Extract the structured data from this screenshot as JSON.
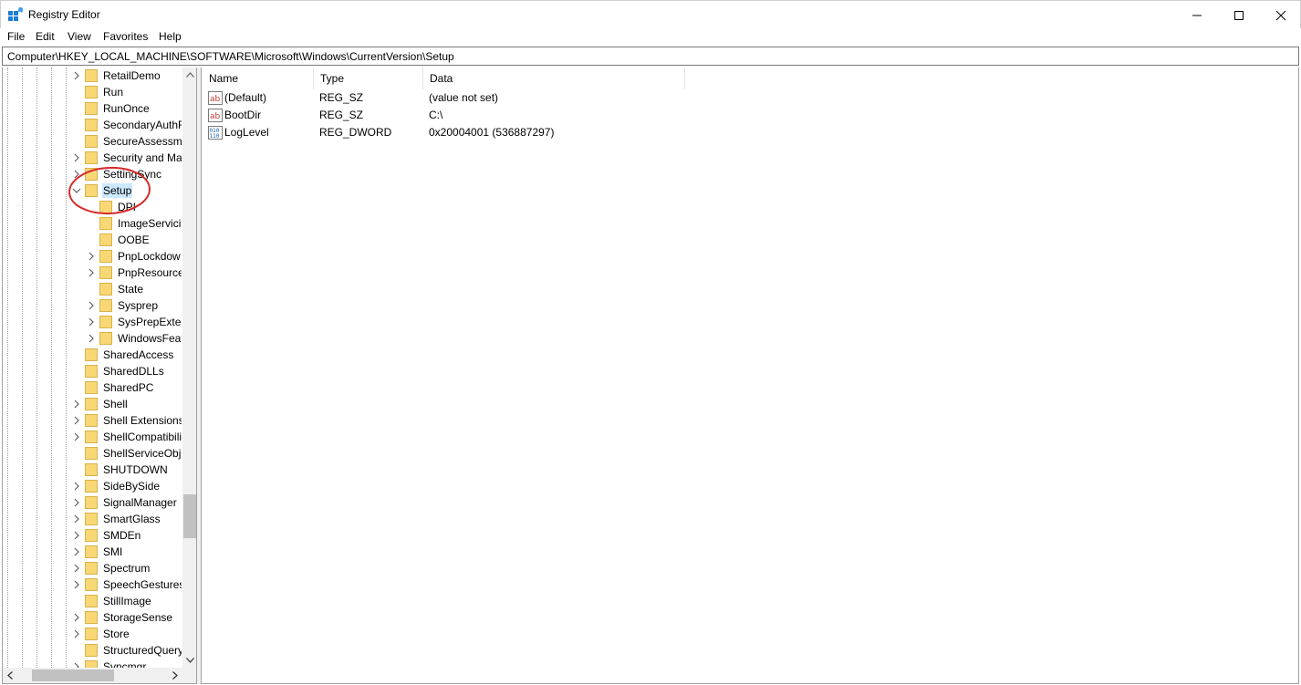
{
  "window": {
    "title": "Registry Editor"
  },
  "menu": {
    "items": [
      "File",
      "Edit",
      "View",
      "Favorites",
      "Help"
    ]
  },
  "address": {
    "path": "Computer\\HKEY_LOCAL_MACHINE\\SOFTWARE\\Microsoft\\Windows\\CurrentVersion\\Setup"
  },
  "tree": {
    "selected": "Setup",
    "items": [
      {
        "label": "RetailDemo",
        "level": 1,
        "expander": "collapsed"
      },
      {
        "label": "Run",
        "level": 1,
        "expander": "none"
      },
      {
        "label": "RunOnce",
        "level": 1,
        "expander": "none"
      },
      {
        "label": "SecondaryAuthF",
        "level": 1,
        "expander": "none"
      },
      {
        "label": "SecureAssessme",
        "level": 1,
        "expander": "none"
      },
      {
        "label": "Security and Ma",
        "level": 1,
        "expander": "collapsed"
      },
      {
        "label": "SettingSync",
        "level": 1,
        "expander": "collapsed"
      },
      {
        "label": "Setup",
        "level": 1,
        "expander": "expanded"
      },
      {
        "label": "DPI",
        "level": 2,
        "expander": "none"
      },
      {
        "label": "ImageServicir",
        "level": 2,
        "expander": "none"
      },
      {
        "label": "OOBE",
        "level": 2,
        "expander": "none"
      },
      {
        "label": "PnpLockdow",
        "level": 2,
        "expander": "collapsed"
      },
      {
        "label": "PnpResource",
        "level": 2,
        "expander": "collapsed"
      },
      {
        "label": "State",
        "level": 2,
        "expander": "none"
      },
      {
        "label": "Sysprep",
        "level": 2,
        "expander": "collapsed"
      },
      {
        "label": "SysPrepExterr",
        "level": 2,
        "expander": "collapsed"
      },
      {
        "label": "WindowsFeat",
        "level": 2,
        "expander": "collapsed"
      },
      {
        "label": "SharedAccess",
        "level": 1,
        "expander": "none"
      },
      {
        "label": "SharedDLLs",
        "level": 1,
        "expander": "none"
      },
      {
        "label": "SharedPC",
        "level": 1,
        "expander": "none"
      },
      {
        "label": "Shell",
        "level": 1,
        "expander": "collapsed"
      },
      {
        "label": "Shell Extensions",
        "level": 1,
        "expander": "collapsed"
      },
      {
        "label": "ShellCompatibili",
        "level": 1,
        "expander": "collapsed"
      },
      {
        "label": "ShellServiceObje",
        "level": 1,
        "expander": "none"
      },
      {
        "label": "SHUTDOWN",
        "level": 1,
        "expander": "none"
      },
      {
        "label": "SideBySide",
        "level": 1,
        "expander": "collapsed"
      },
      {
        "label": "SignalManager",
        "level": 1,
        "expander": "collapsed"
      },
      {
        "label": "SmartGlass",
        "level": 1,
        "expander": "collapsed"
      },
      {
        "label": "SMDEn",
        "level": 1,
        "expander": "collapsed"
      },
      {
        "label": "SMI",
        "level": 1,
        "expander": "collapsed"
      },
      {
        "label": "Spectrum",
        "level": 1,
        "expander": "collapsed"
      },
      {
        "label": "SpeechGestures",
        "level": 1,
        "expander": "collapsed"
      },
      {
        "label": "StillImage",
        "level": 1,
        "expander": "none"
      },
      {
        "label": "StorageSense",
        "level": 1,
        "expander": "collapsed"
      },
      {
        "label": "Store",
        "level": 1,
        "expander": "collapsed"
      },
      {
        "label": "StructuredQuery",
        "level": 1,
        "expander": "none"
      },
      {
        "label": "Syncmgr",
        "level": 1,
        "expander": "collapsed"
      }
    ]
  },
  "list": {
    "columns": [
      "Name",
      "Type",
      "Data"
    ],
    "rows": [
      {
        "name": "(Default)",
        "type": "REG_SZ",
        "data": "(value not set)",
        "icon": "string-value-icon"
      },
      {
        "name": "BootDir",
        "type": "REG_SZ",
        "data": "C:\\",
        "icon": "string-value-icon"
      },
      {
        "name": "LogLevel",
        "type": "REG_DWORD",
        "data": "0x20004001 (536887297)",
        "icon": "binary-value-icon"
      }
    ]
  },
  "colors": {
    "selection": "#cce8ff",
    "folder": "#f8d775",
    "annotation": "#d42a2a"
  }
}
